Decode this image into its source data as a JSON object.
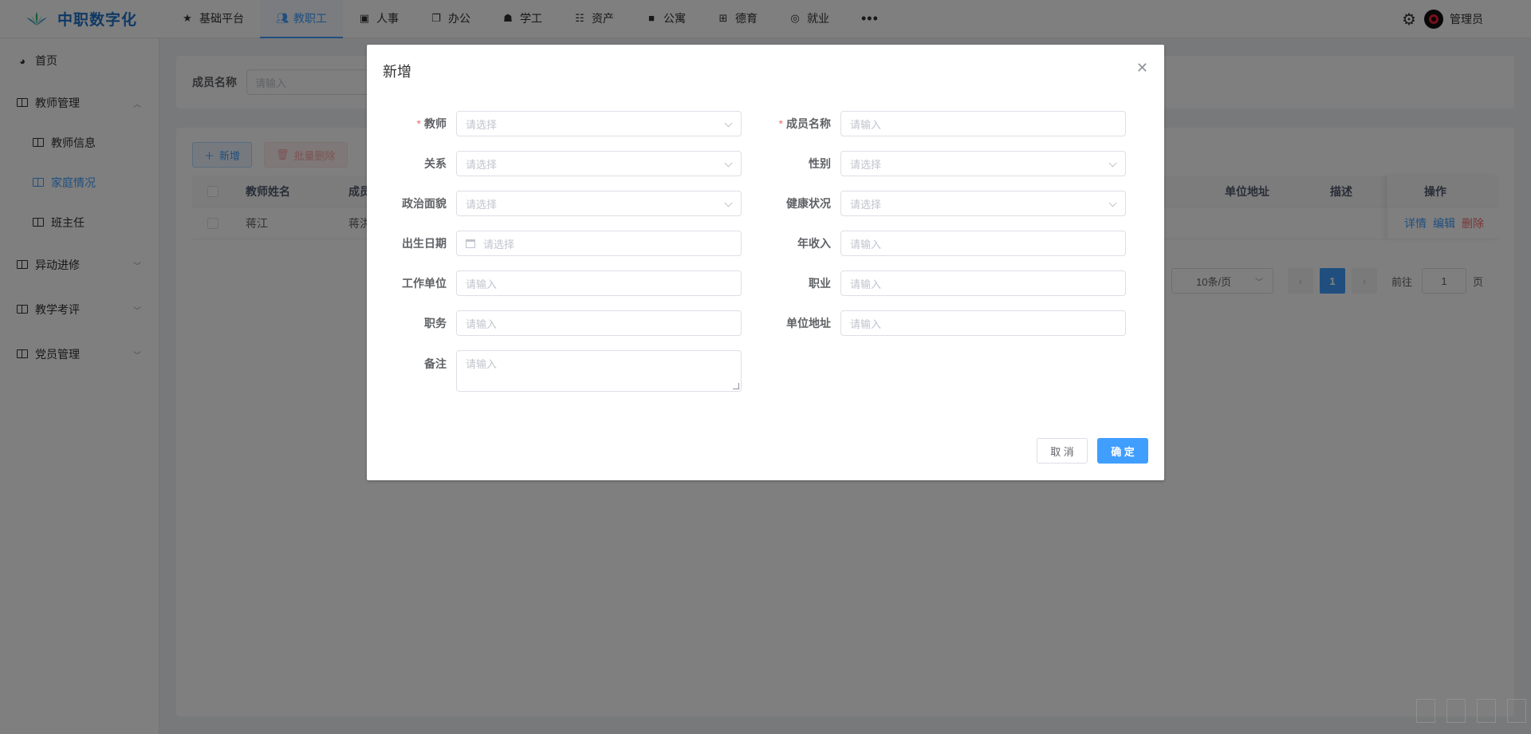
{
  "app": {
    "title": "中职数字化"
  },
  "topnav": {
    "items": [
      {
        "label": "基础平台",
        "icon": "star-icon"
      },
      {
        "label": "教职工",
        "icon": "user-group-icon",
        "active": true
      },
      {
        "label": "人事",
        "icon": "id-card-icon"
      },
      {
        "label": "办公",
        "icon": "document-icon"
      },
      {
        "label": "学工",
        "icon": "student-icon"
      },
      {
        "label": "资产",
        "icon": "assets-icon"
      },
      {
        "label": "公寓",
        "icon": "apartment-icon"
      },
      {
        "label": "德育",
        "icon": "grid-icon"
      },
      {
        "label": "就业",
        "icon": "target-icon"
      }
    ],
    "more": "•••",
    "username": "管理员"
  },
  "sidebar": {
    "home": "首页",
    "teacher_mgmt": "教师管理",
    "teacher_info": "教师信息",
    "family": "家庭情况",
    "head_teacher": "班主任",
    "transfer": "异动进修",
    "evaluation": "教学考评",
    "party": "党员管理"
  },
  "search": {
    "label": "成员名称",
    "placeholder": "请输入"
  },
  "toolbar": {
    "add": "新增",
    "batch_delete": "批量删除"
  },
  "table": {
    "headers": {
      "teacher_name": "教师姓名",
      "member": "成员",
      "address": "单位地址",
      "desc": "描述",
      "ops": "操作"
    },
    "rows": [
      {
        "teacher_name": "蒋江",
        "member": "蒋洪"
      }
    ],
    "ops": {
      "detail": "详情",
      "edit": "编辑",
      "delete": "删除"
    }
  },
  "pager": {
    "page_size": "10条/页",
    "current_page": "1",
    "goto": "前往",
    "goto_value": "1",
    "page_unit": "页"
  },
  "dialog": {
    "title": "新增",
    "fields": {
      "teacher": {
        "label": "教师",
        "placeholder": "请选择"
      },
      "member_name": {
        "label": "成员名称",
        "placeholder": "请输入"
      },
      "relation": {
        "label": "关系",
        "placeholder": "请选择"
      },
      "gender": {
        "label": "性别",
        "placeholder": "请选择"
      },
      "politics": {
        "label": "政治面貌",
        "placeholder": "请选择"
      },
      "health": {
        "label": "健康状况",
        "placeholder": "请选择"
      },
      "birthday": {
        "label": "出生日期",
        "placeholder": "请选择"
      },
      "income": {
        "label": "年收入",
        "placeholder": "请输入"
      },
      "work_unit": {
        "label": "工作单位",
        "placeholder": "请输入"
      },
      "occupation": {
        "label": "职业",
        "placeholder": "请输入"
      },
      "position": {
        "label": "职务",
        "placeholder": "请输入"
      },
      "unit_address": {
        "label": "单位地址",
        "placeholder": "请输入"
      },
      "remark": {
        "label": "备注",
        "placeholder": "请输入"
      }
    },
    "cancel": "取 消",
    "confirm": "确 定"
  },
  "colors": {
    "primary": "#409eff",
    "danger": "#f56c6c",
    "brand": "#1f72c9",
    "overlay": "rgba(0,0,0,0.5)"
  }
}
